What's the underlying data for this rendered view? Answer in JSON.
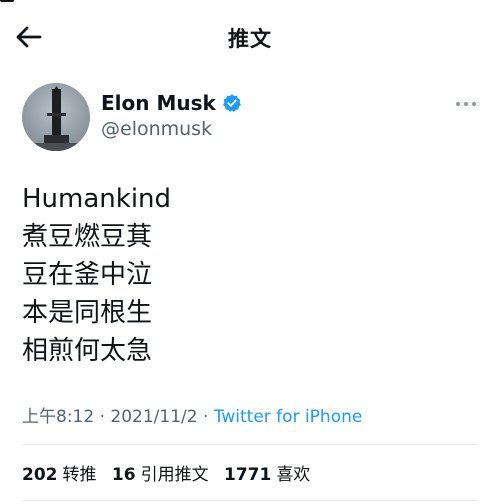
{
  "header": {
    "title": "推文"
  },
  "author": {
    "display_name": "Elon Musk",
    "handle": "@elonmusk",
    "verified": true
  },
  "tweet": {
    "lines": [
      "Humankind",
      "煮豆燃豆萁",
      "豆在釜中泣",
      "本是同根生",
      "相煎何太急"
    ],
    "time": "上午8:12",
    "separator": " · ",
    "date": "2021/11/2",
    "source": "Twitter for iPhone"
  },
  "stats": {
    "retweets_count": "202",
    "retweets_label": "转推",
    "quotes_count": "16",
    "quotes_label": "引用推文",
    "likes_count": "1771",
    "likes_label": "喜欢"
  },
  "colors": {
    "accent": "#1d9bf0",
    "text": "#0f1419",
    "secondary": "#536471"
  },
  "icons": {
    "back": "arrow-left-icon",
    "verified": "verified-badge-icon",
    "more": "more-horizontal-icon"
  }
}
